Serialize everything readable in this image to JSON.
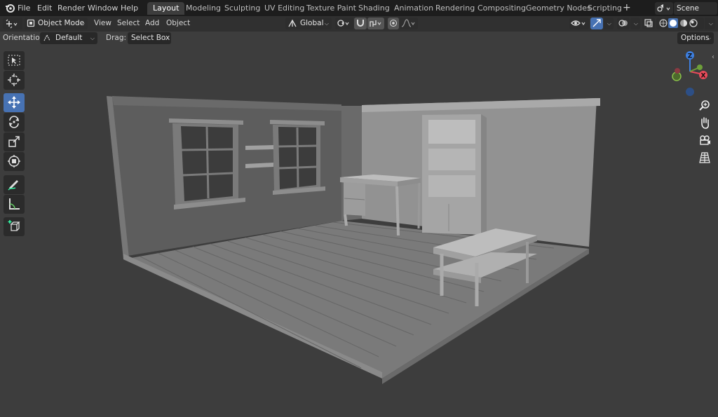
{
  "menu": [
    "File",
    "Edit",
    "Render",
    "Window",
    "Help"
  ],
  "workspaces": [
    "Layout",
    "Modeling",
    "Sculpting",
    "UV Editing",
    "Texture Paint",
    "Shading",
    "Animation",
    "Rendering",
    "Compositing",
    "Geometry Nodes",
    "Scripting"
  ],
  "active_workspace": "Layout",
  "scene": "Scene",
  "header": {
    "mode": "Object Mode",
    "menus": [
      "View",
      "Select",
      "Add",
      "Object"
    ],
    "orientation_global": "Global"
  },
  "tool_settings": {
    "orientation_label": "Orientation:",
    "orientation_value": "Default",
    "drag_label": "Drag:",
    "drag_value": "Select Box",
    "options_label": "Options"
  },
  "toolbar": {
    "active_tool": "move",
    "tools": [
      "select-box",
      "cursor",
      "move",
      "rotate",
      "scale",
      "transform",
      "annotate",
      "measure",
      "add-cube"
    ]
  },
  "gizmo": {
    "z": "Z",
    "x": "X"
  },
  "colors": {
    "accent": "#4772b3",
    "axis_x": "#e94a5a",
    "axis_y": "#6ea03a",
    "axis_z": "#3d7fe0",
    "viewport_bg": "#3d3d3d"
  }
}
